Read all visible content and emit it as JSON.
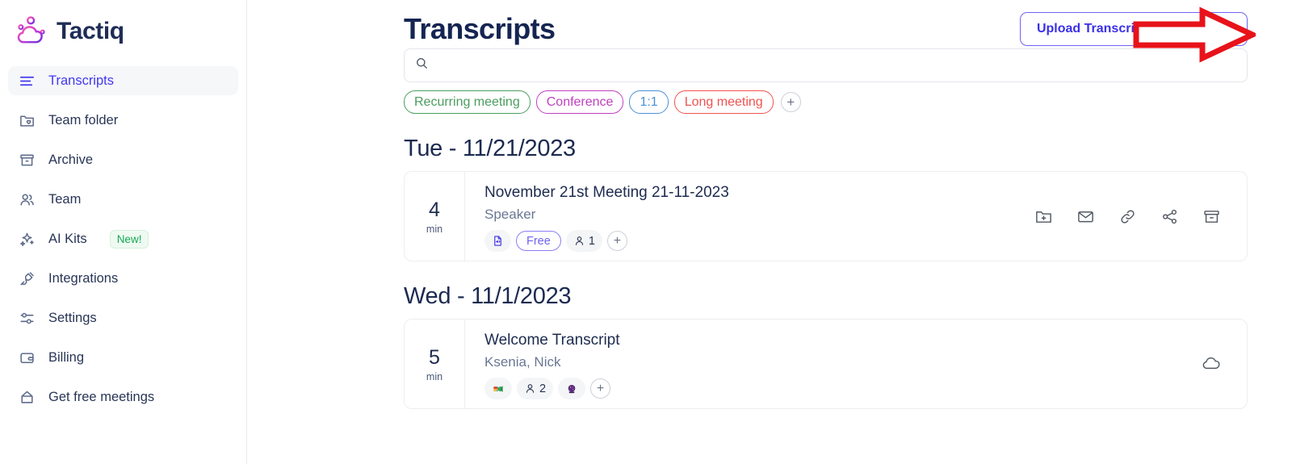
{
  "brand": {
    "name": "Tactiq",
    "logo_icon": "cloud-logo-icon"
  },
  "sidebar": {
    "items": [
      {
        "label": "Transcripts",
        "icon": "lines-icon",
        "active": true
      },
      {
        "label": "Team folder",
        "icon": "folder-heart-icon",
        "active": false
      },
      {
        "label": "Archive",
        "icon": "archive-icon",
        "active": false
      },
      {
        "label": "Team",
        "icon": "people-icon",
        "active": false
      },
      {
        "label": "AI Kits",
        "icon": "sparkles-icon",
        "active": false,
        "badge": "New!"
      },
      {
        "label": "Integrations",
        "icon": "plug-icon",
        "active": false
      },
      {
        "label": "Settings",
        "icon": "sliders-icon",
        "active": false
      },
      {
        "label": "Billing",
        "icon": "wallet-icon",
        "active": false
      },
      {
        "label": "Get free meetings",
        "icon": "gift-icon",
        "active": false
      }
    ]
  },
  "header": {
    "title": "Transcripts",
    "upload_label": "Upload Transcript or Recording"
  },
  "search": {
    "value": "",
    "placeholder": "",
    "icon": "search-icon"
  },
  "tags": {
    "items": [
      {
        "label": "Recurring meeting",
        "color": "#4a9d5f"
      },
      {
        "label": "Conference",
        "color": "#c040c0"
      },
      {
        "label": "1:1",
        "color": "#4a90d9"
      },
      {
        "label": "Long meeting",
        "color": "#ef5350"
      }
    ],
    "add_label": "+"
  },
  "groups": [
    {
      "date_label": "Tue - 11/21/2023",
      "cards": [
        {
          "duration": "4",
          "duration_unit": "min",
          "title": "November 21st Meeting 21-11-2023",
          "subtitle": "Speaker",
          "source_icon": "audio-document-icon",
          "plan_badge": "Free",
          "participants": "1",
          "add_label": "+",
          "actions": [
            {
              "icon": "folder-plus-icon"
            },
            {
              "icon": "envelope-icon"
            },
            {
              "icon": "link-icon"
            },
            {
              "icon": "share-icon"
            },
            {
              "icon": "archive-icon"
            }
          ]
        }
      ]
    },
    {
      "date_label": "Wed - 11/1/2023",
      "cards": [
        {
          "duration": "5",
          "duration_unit": "min",
          "title": "Welcome Transcript",
          "subtitle": "Ksenia, Nick",
          "source_icon": "google-meet-icon",
          "participants": "2",
          "avatar_icon": "crystal-ball-avatar-icon",
          "add_label": "+",
          "actions": [
            {
              "icon": "cloud-icon"
            }
          ]
        }
      ]
    }
  ],
  "annotation": {
    "arrow_color": "#e8131a",
    "points_to": "upload-transcript-button"
  },
  "colors": {
    "accent": "#4338f0",
    "title": "#152552",
    "badge_new": "#18a957"
  }
}
